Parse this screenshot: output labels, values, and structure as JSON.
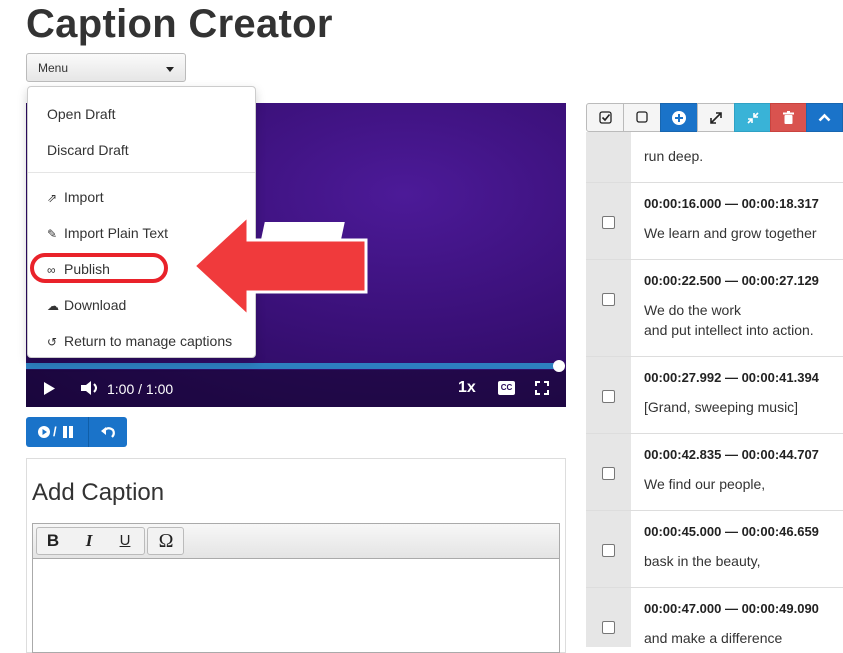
{
  "app": {
    "title": "Caption Creator"
  },
  "menu": {
    "label": "Menu",
    "items": [
      {
        "label": "Open Draft",
        "icon": ""
      },
      {
        "label": "Discard Draft",
        "icon": ""
      },
      {
        "label": "Import",
        "icon": "external-link-icon"
      },
      {
        "label": "Import Plain Text",
        "icon": "edit-icon"
      },
      {
        "label": "Publish",
        "icon": "link-icon"
      },
      {
        "label": "Download",
        "icon": "cloud-download-icon"
      },
      {
        "label": "Return to manage captions",
        "icon": "undo-icon"
      }
    ]
  },
  "player": {
    "current_time": "1:00",
    "separator": "/",
    "duration": "1:00",
    "speed": "1x",
    "cc_label": "CC",
    "progress": 1.0
  },
  "controls": {
    "play_pause_label": "▶/❚❚",
    "undo_label": "↶"
  },
  "add_caption": {
    "heading": "Add Caption",
    "toolbar": {
      "bold": "B",
      "italic": "I",
      "underline": "U",
      "special_char": "Ω"
    }
  },
  "caption_toolbar": {
    "buttons": [
      {
        "name": "check-all-button",
        "icon": "check-square-icon",
        "color": "#f5f5f5"
      },
      {
        "name": "uncheck-all-button",
        "icon": "square-icon",
        "color": "#f5f5f5"
      },
      {
        "name": "add-caption-button",
        "icon": "plus-circle-icon",
        "color": "#1a73c9"
      },
      {
        "name": "expand-button",
        "icon": "expand-icon",
        "color": "#f5f5f5"
      },
      {
        "name": "compress-button",
        "icon": "compress-icon",
        "color": "#39b3d7"
      },
      {
        "name": "delete-button",
        "icon": "trash-icon",
        "color": "#d9534f"
      },
      {
        "name": "collapse-button",
        "icon": "chevron-up-icon",
        "color": "#1a73c9"
      }
    ]
  },
  "captions": [
    {
      "time": "",
      "lines": [
        "run deep."
      ]
    },
    {
      "time": "00:00:16.000 — 00:00:18.317",
      "lines": [
        "We learn and grow together"
      ]
    },
    {
      "time": "00:00:22.500 — 00:00:27.129",
      "lines": [
        "We do the work",
        "and put intellect into action."
      ]
    },
    {
      "time": "00:00:27.992 — 00:00:41.394",
      "lines": [
        "[Grand, sweeping music]"
      ]
    },
    {
      "time": "00:00:42.835 — 00:00:44.707",
      "lines": [
        "We find our people,"
      ]
    },
    {
      "time": "00:00:45.000 — 00:00:46.659",
      "lines": [
        "bask in the beauty,"
      ]
    },
    {
      "time": "00:00:47.000 — 00:00:49.090",
      "lines": [
        "and make a difference"
      ]
    }
  ],
  "annotation": {
    "highlight_color": "#e9222a"
  }
}
